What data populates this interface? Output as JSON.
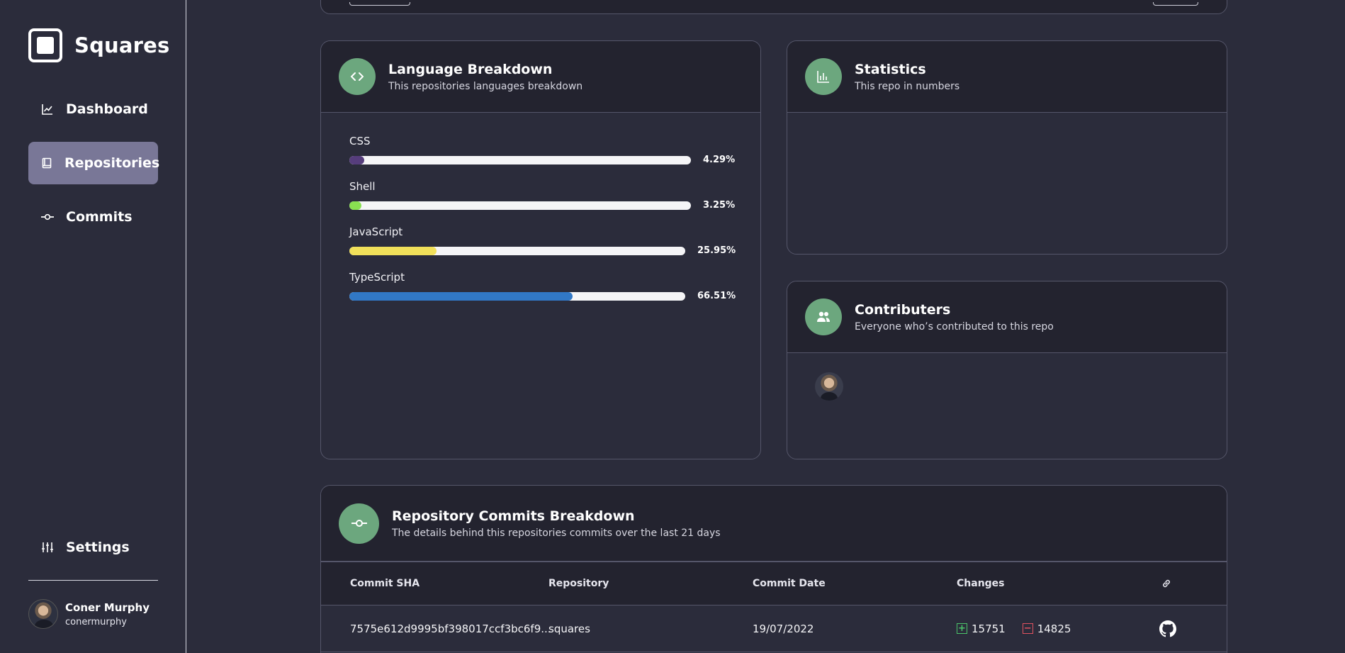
{
  "brand": {
    "name": "Squares"
  },
  "nav": {
    "items": [
      {
        "label": "Dashboard",
        "icon": "chart-line-icon",
        "active": false
      },
      {
        "label": "Repositories",
        "icon": "book-icon",
        "active": true
      },
      {
        "label": "Commits",
        "icon": "commit-icon",
        "active": false
      }
    ],
    "settings_label": "Settings"
  },
  "user": {
    "name": "Coner Murphy",
    "handle": "conermurphy"
  },
  "language_card": {
    "title": "Language Breakdown",
    "subtitle": "This repositories languages breakdown",
    "languages": [
      {
        "name": "CSS",
        "percent_label": "4.29%",
        "percent": 4.29,
        "color": "#563d7c"
      },
      {
        "name": "Shell",
        "percent_label": "3.25%",
        "percent": 3.25,
        "color": "#89e051"
      },
      {
        "name": "JavaScript",
        "percent_label": "25.95%",
        "percent": 25.95,
        "color": "#f1e05a"
      },
      {
        "name": "TypeScript",
        "percent_label": "66.51%",
        "percent": 66.51,
        "color": "#3178c6"
      }
    ]
  },
  "statistics_card": {
    "title": "Statistics",
    "subtitle": "This repo in numbers"
  },
  "contributors_card": {
    "title": "Contributers",
    "subtitle": "Everyone who’s contributed to this repo"
  },
  "commits_card": {
    "title": "Repository Commits Breakdown",
    "subtitle": "The details behind this repositories commits over the last 21 days",
    "columns": [
      "Commit SHA",
      "Repository",
      "Commit Date",
      "Changes"
    ],
    "rows": [
      {
        "sha": "7575e612d9995bf398017ccf3bc6f9...",
        "repository": "squares",
        "date": "19/07/2022",
        "additions": "15751",
        "deletions": "14825"
      }
    ]
  },
  "colors": {
    "accent": "#6ca77e",
    "active_nav": "#797797",
    "background": "#2b2c3b",
    "card_header": "#23232f"
  }
}
